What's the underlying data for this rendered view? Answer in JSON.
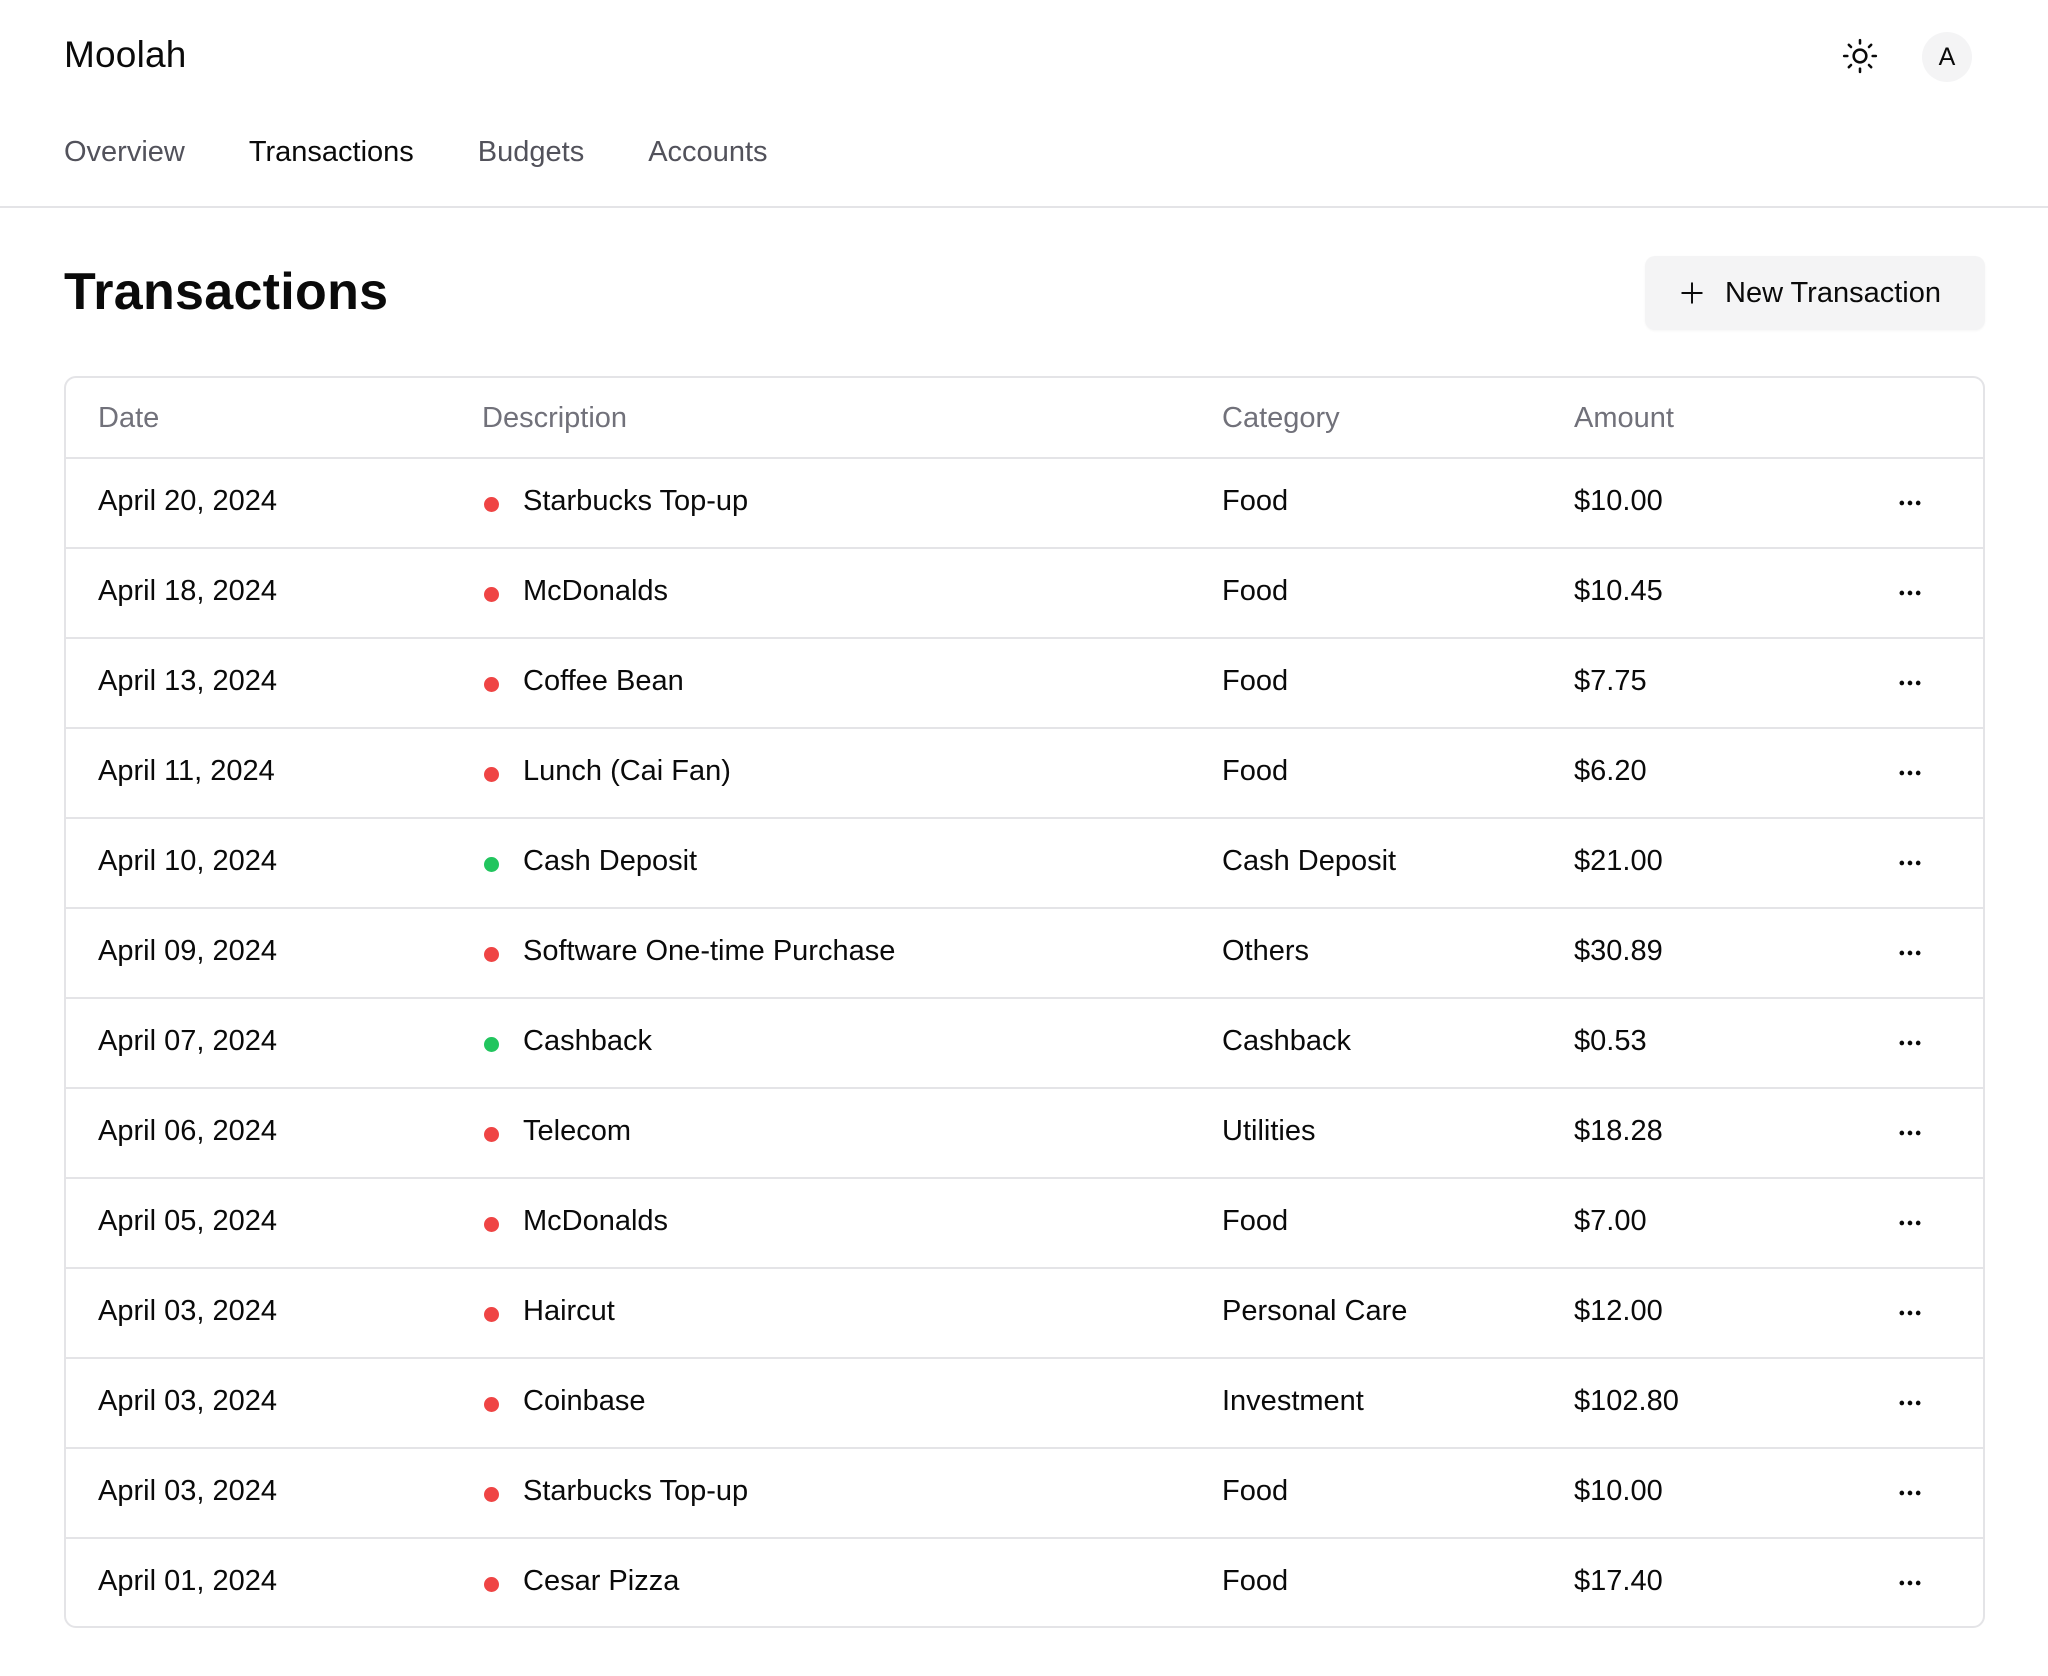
{
  "app": {
    "name": "Moolah",
    "theme_icon": "sun-icon",
    "avatar_initial": "A"
  },
  "nav": {
    "tabs": [
      {
        "label": "Overview",
        "active": false
      },
      {
        "label": "Transactions",
        "active": true
      },
      {
        "label": "Budgets",
        "active": false
      },
      {
        "label": "Accounts",
        "active": false
      }
    ]
  },
  "page": {
    "title": "Transactions",
    "new_button_label": "New Transaction",
    "new_button_icon": "plus-icon"
  },
  "colors": {
    "expense": "#ef4444",
    "income": "#22c55e"
  },
  "table": {
    "headers": {
      "date": "Date",
      "description": "Description",
      "category": "Category",
      "amount": "Amount"
    },
    "row_action_icon": "more-horizontal-icon",
    "rows": [
      {
        "date": "April 20, 2024",
        "description": "Starbucks Top-up",
        "category": "Food",
        "amount": "$10.00",
        "type": "expense"
      },
      {
        "date": "April 18, 2024",
        "description": "McDonalds",
        "category": "Food",
        "amount": "$10.45",
        "type": "expense"
      },
      {
        "date": "April 13, 2024",
        "description": "Coffee Bean",
        "category": "Food",
        "amount": "$7.75",
        "type": "expense"
      },
      {
        "date": "April 11, 2024",
        "description": "Lunch (Cai Fan)",
        "category": "Food",
        "amount": "$6.20",
        "type": "expense"
      },
      {
        "date": "April 10, 2024",
        "description": "Cash Deposit",
        "category": "Cash Deposit",
        "amount": "$21.00",
        "type": "income"
      },
      {
        "date": "April 09, 2024",
        "description": "Software One-time Purchase",
        "category": "Others",
        "amount": "$30.89",
        "type": "expense"
      },
      {
        "date": "April 07, 2024",
        "description": "Cashback",
        "category": "Cashback",
        "amount": "$0.53",
        "type": "income"
      },
      {
        "date": "April 06, 2024",
        "description": "Telecom",
        "category": "Utilities",
        "amount": "$18.28",
        "type": "expense"
      },
      {
        "date": "April 05, 2024",
        "description": "McDonalds",
        "category": "Food",
        "amount": "$7.00",
        "type": "expense"
      },
      {
        "date": "April 03, 2024",
        "description": "Haircut",
        "category": "Personal Care",
        "amount": "$12.00",
        "type": "expense"
      },
      {
        "date": "April 03, 2024",
        "description": "Coinbase",
        "category": "Investment",
        "amount": "$102.80",
        "type": "expense"
      },
      {
        "date": "April 03, 2024",
        "description": "Starbucks Top-up",
        "category": "Food",
        "amount": "$10.00",
        "type": "expense"
      },
      {
        "date": "April 01, 2024",
        "description": "Cesar Pizza",
        "category": "Food",
        "amount": "$17.40",
        "type": "expense"
      }
    ]
  }
}
